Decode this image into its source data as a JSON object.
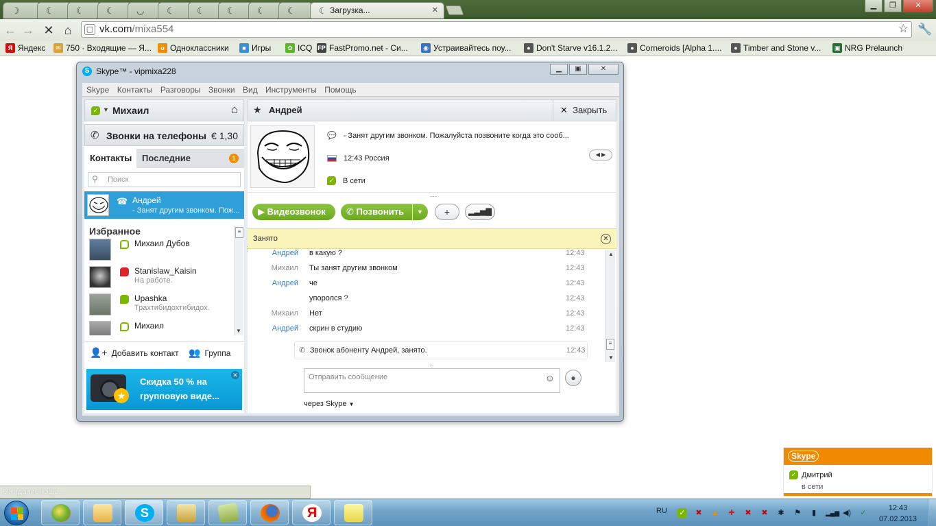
{
  "browser": {
    "active_tab_title": "Загрузка...",
    "url_host": "vk.com",
    "url_path": "/mixa554",
    "bookmarks": [
      {
        "label": "Яндекс",
        "color": "#cc1111",
        "glyph": "Я"
      },
      {
        "label": "750 · Входящие — Я...",
        "color": "#d9a23a",
        "glyph": "✉"
      },
      {
        "label": "Одноклассники",
        "color": "#f28c00",
        "glyph": "о"
      },
      {
        "label": "Игры",
        "color": "#3a8fd6",
        "glyph": "■"
      },
      {
        "label": "ICQ",
        "color": "#5ab52a",
        "glyph": "✿"
      },
      {
        "label": "FastPromo.net - Си...",
        "color": "#444444",
        "glyph": "FP"
      },
      {
        "label": "Устраивайтесь поу...",
        "color": "#3b6fbf",
        "glyph": "◉"
      },
      {
        "label": "Don't Starve v16.1.2...",
        "color": "#555555",
        "glyph": "●"
      },
      {
        "label": "Corneroids [Alpha 1....",
        "color": "#555555",
        "glyph": "●"
      },
      {
        "label": "Timber and Stone v...",
        "color": "#555555",
        "glyph": "●"
      },
      {
        "label": "NRG Prelaunch",
        "color": "#2a6b3a",
        "glyph": "▣"
      }
    ],
    "status_bubble": "Ожидание кэша..."
  },
  "skype": {
    "window_title": "Skype™ - vipmixa228",
    "menu": [
      "Skype",
      "Контакты",
      "Разговоры",
      "Звонки",
      "Вид",
      "Инструменты",
      "Помощь"
    ],
    "me_name": "Михаил",
    "calls_label": "Звонки на телефоны",
    "calls_price": "€ 1,30",
    "tab_contacts": "Контакты",
    "tab_recent": "Последние",
    "recent_badge": "1",
    "search_placeholder": "Поиск",
    "selected_contact": {
      "name": "Андрей",
      "mood": "- Занят другим звонком. Пож..."
    },
    "favorites_header": "Избранное",
    "favorites": [
      {
        "name": "Михаил  Дубов",
        "mood": "",
        "status": "offline"
      },
      {
        "name": "Stanislaw_Kaisin",
        "mood": "На работе.",
        "status": "dnd"
      },
      {
        "name": "Upashka",
        "mood": "Трахтибидохтибидох.",
        "status": "online"
      },
      {
        "name": "Михаил",
        "mood": "",
        "status": "offline"
      }
    ],
    "add_contact": "Добавить контакт",
    "group": "Группа",
    "ad_text_1": "Скидка 50 % на",
    "ad_text_2": "групповую виде...",
    "conv_name": "Андрей",
    "close_label": "Закрыть",
    "profile_mood": "- Занят другим звонком. Пожалуйста позвоните когда это сооб...",
    "profile_time": "12:43 Россия",
    "profile_status": "В сети",
    "video_call": "Видеозвонок",
    "call": "Позвонить",
    "busy_text": "Занято",
    "messages": [
      {
        "author": "Андрей",
        "me": false,
        "text": "в какую ?",
        "time": "12:43"
      },
      {
        "author": "Михаил",
        "me": true,
        "text": "Ты занят другим звонком",
        "time": "12:43"
      },
      {
        "author": "Андрей",
        "me": false,
        "text": "че",
        "time": "12:43"
      },
      {
        "author": "",
        "me": true,
        "text": "упоролся ?",
        "time": "12:43"
      },
      {
        "author": "Михаил",
        "me": true,
        "text": "Нет",
        "time": "12:43"
      },
      {
        "author": "Андрей",
        "me": false,
        "text": "скрин в студию",
        "time": "12:43"
      }
    ],
    "call_note": {
      "text": "Звонок абоненту Андрей, занято.",
      "time": "12:43"
    },
    "compose_placeholder": "Отправить сообщение",
    "via": "через Skype"
  },
  "notification": {
    "brand": "Skype",
    "name": "Дмитрий",
    "status": "в сети"
  },
  "taskbar": {
    "lang": "RU",
    "time": "12:43",
    "date": "07.02.2013"
  },
  "colors": {
    "skype_blue": "#00aff0",
    "skype_green": "#7ab800",
    "notify_orange": "#f08a00",
    "selection_blue": "#2e9fd8"
  }
}
